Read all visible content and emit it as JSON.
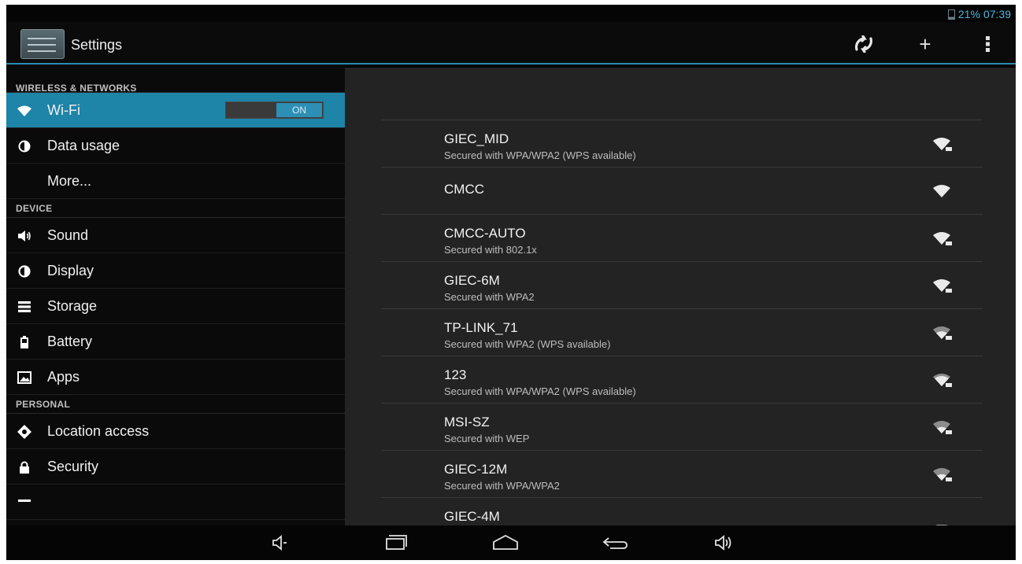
{
  "status": {
    "battery": "21%",
    "time": "07:39"
  },
  "action_bar": {
    "title": "Settings",
    "icons": [
      "settings-app-icon",
      "wps-icon",
      "add-icon",
      "overflow-menu-icon"
    ],
    "add_label": "+"
  },
  "sidebar": {
    "sections": [
      {
        "label": "WIRELESS & NETWORKS"
      },
      {
        "label": "DEVICE"
      },
      {
        "label": "PERSONAL"
      }
    ],
    "items": [
      {
        "label": "Wi-Fi",
        "icon": "wifi-icon",
        "selected": true,
        "toggle": "ON"
      },
      {
        "label": "Data usage",
        "icon": "data-usage-icon"
      },
      {
        "label": "More..."
      },
      {
        "label": "Sound",
        "icon": "speaker-icon"
      },
      {
        "label": "Display",
        "icon": "display-icon"
      },
      {
        "label": "Storage",
        "icon": "storage-icon"
      },
      {
        "label": "Battery",
        "icon": "battery-icon"
      },
      {
        "label": "Apps",
        "icon": "apps-icon"
      },
      {
        "label": "Location access",
        "icon": "location-icon"
      },
      {
        "label": "Security",
        "icon": "lock-icon"
      }
    ]
  },
  "networks": [
    {
      "ssid": "GIEC_MID",
      "security": "Secured with WPA/WPA2 (WPS available)",
      "secured": true
    },
    {
      "ssid": "CMCC",
      "security": "",
      "secured": false
    },
    {
      "ssid": "CMCC-AUTO",
      "security": "Secured with 802.1x",
      "secured": true
    },
    {
      "ssid": "GIEC-6M",
      "security": "Secured with WPA2",
      "secured": true
    },
    {
      "ssid": "TP-LINK_71",
      "security": "Secured with WPA2 (WPS available)",
      "secured": true
    },
    {
      "ssid": "123",
      "security": "Secured with WPA/WPA2 (WPS available)",
      "secured": true
    },
    {
      "ssid": "MSI-SZ",
      "security": "Secured with WEP",
      "secured": true
    },
    {
      "ssid": "GIEC-12M",
      "security": "Secured with WPA/WPA2",
      "secured": true
    },
    {
      "ssid": "GIEC-4M",
      "security": "",
      "secured": true
    }
  ],
  "nav_bar": {
    "icons": [
      "volume-down-icon",
      "recent-apps-icon",
      "home-icon",
      "back-icon",
      "volume-up-icon"
    ]
  },
  "colors": {
    "accent": "#2a8bb0",
    "selected": "#1e84a8",
    "status_text": "#4fb6e0"
  }
}
